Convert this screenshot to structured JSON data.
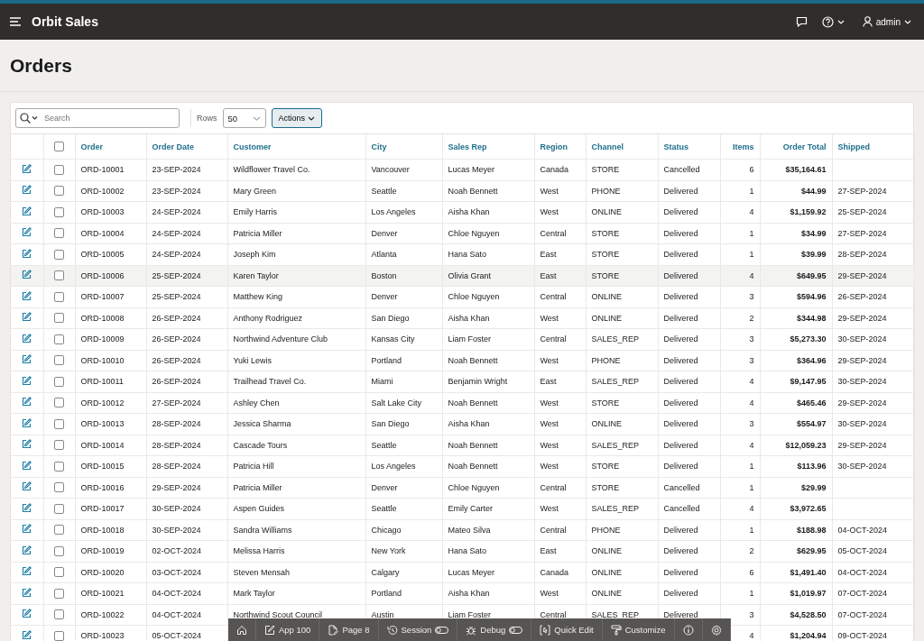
{
  "header": {
    "app_name": "Orbit Sales",
    "user": "admin"
  },
  "page_title": "Orders",
  "toolbar": {
    "search_placeholder": "Search",
    "rows_label": "Rows",
    "rows_value": "50",
    "actions_label": "Actions"
  },
  "select_all_checked": false,
  "columns": [
    "Order",
    "Order Date",
    "Customer",
    "City",
    "Sales Rep",
    "Region",
    "Channel",
    "Status",
    "Items",
    "Order Total",
    "Shipped"
  ],
  "rows": [
    {
      "order": "ORD-10001",
      "date": "23-SEP-2024",
      "customer": "Wildflower Travel Co.",
      "city": "Vancouver",
      "rep": "Lucas Meyer",
      "region": "Canada",
      "channel": "STORE",
      "status": "Cancelled",
      "items": "6",
      "total": "$35,164.61",
      "highlighted": false
    },
    {
      "order": "ORD-10002",
      "date": "23-SEP-2024",
      "customer": "Mary Green",
      "city": "Seattle",
      "rep": "Noah Bennett",
      "region": "West",
      "channel": "PHONE",
      "status": "Delivered",
      "items": "1",
      "total": "$44.99",
      "shipped": "27-SEP-2024",
      "highlighted": false
    },
    {
      "order": "ORD-10003",
      "date": "24-SEP-2024",
      "customer": "Emily Harris",
      "city": "Los Angeles",
      "rep": "Aisha Khan",
      "region": "West",
      "channel": "ONLINE",
      "status": "Delivered",
      "items": "4",
      "total": "$1,159.92",
      "shipped": "25-SEP-2024",
      "highlighted": false
    },
    {
      "order": "ORD-10004",
      "date": "24-SEP-2024",
      "customer": "Patricia Miller",
      "city": "Denver",
      "rep": "Chloe Nguyen",
      "region": "Central",
      "channel": "STORE",
      "status": "Delivered",
      "items": "1",
      "total": "$34.99",
      "shipped": "27-SEP-2024",
      "highlighted": false
    },
    {
      "order": "ORD-10005",
      "date": "24-SEP-2024",
      "customer": "Joseph Kim",
      "city": "Atlanta",
      "rep": "Hana Sato",
      "region": "East",
      "channel": "STORE",
      "status": "Delivered",
      "items": "1",
      "total": "$39.99",
      "shipped": "28-SEP-2024",
      "highlighted": false
    },
    {
      "order": "ORD-10006",
      "date": "25-SEP-2024",
      "customer": "Karen Taylor",
      "city": "Boston",
      "rep": "Olivia Grant",
      "region": "East",
      "channel": "STORE",
      "status": "Delivered",
      "items": "4",
      "total": "$649.95",
      "shipped": "29-SEP-2024",
      "highlighted": true
    },
    {
      "order": "ORD-10007",
      "date": "25-SEP-2024",
      "customer": "Matthew King",
      "city": "Denver",
      "rep": "Chloe Nguyen",
      "region": "Central",
      "channel": "ONLINE",
      "status": "Delivered",
      "items": "3",
      "total": "$594.96",
      "shipped": "26-SEP-2024",
      "highlighted": false
    },
    {
      "order": "ORD-10008",
      "date": "26-SEP-2024",
      "customer": "Anthony Rodriguez",
      "city": "San Diego",
      "rep": "Aisha Khan",
      "region": "West",
      "channel": "ONLINE",
      "status": "Delivered",
      "items": "2",
      "total": "$344.98",
      "shipped": "29-SEP-2024",
      "highlighted": false
    },
    {
      "order": "ORD-10009",
      "date": "26-SEP-2024",
      "customer": "Northwind Adventure Club",
      "city": "Kansas City",
      "rep": "Liam Foster",
      "region": "Central",
      "channel": "SALES_REP",
      "status": "Delivered",
      "items": "3",
      "total": "$5,273.30",
      "shipped": "30-SEP-2024",
      "highlighted": false
    },
    {
      "order": "ORD-10010",
      "date": "26-SEP-2024",
      "customer": "Yuki Lewis",
      "city": "Portland",
      "rep": "Noah Bennett",
      "region": "West",
      "channel": "PHONE",
      "status": "Delivered",
      "items": "3",
      "total": "$364.96",
      "shipped": "29-SEP-2024",
      "highlighted": false
    },
    {
      "order": "ORD-10011",
      "date": "26-SEP-2024",
      "customer": "Trailhead Travel Co.",
      "city": "Miami",
      "rep": "Benjamin Wright",
      "region": "East",
      "channel": "SALES_REP",
      "status": "Delivered",
      "items": "4",
      "total": "$9,147.95",
      "shipped": "30-SEP-2024",
      "highlighted": false
    },
    {
      "order": "ORD-10012",
      "date": "27-SEP-2024",
      "customer": "Ashley Chen",
      "city": "Salt Lake City",
      "rep": "Noah Bennett",
      "region": "West",
      "channel": "STORE",
      "status": "Delivered",
      "items": "4",
      "total": "$465.46",
      "shipped": "29-SEP-2024",
      "highlighted": false
    },
    {
      "order": "ORD-10013",
      "date": "28-SEP-2024",
      "customer": "Jessica Sharma",
      "city": "San Diego",
      "rep": "Aisha Khan",
      "region": "West",
      "channel": "ONLINE",
      "status": "Delivered",
      "items": "3",
      "total": "$554.97",
      "shipped": "30-SEP-2024",
      "highlighted": false
    },
    {
      "order": "ORD-10014",
      "date": "28-SEP-2024",
      "customer": "Cascade Tours",
      "city": "Seattle",
      "rep": "Noah Bennett",
      "region": "West",
      "channel": "SALES_REP",
      "status": "Delivered",
      "items": "4",
      "total": "$12,059.23",
      "shipped": "29-SEP-2024",
      "highlighted": false
    },
    {
      "order": "ORD-10015",
      "date": "28-SEP-2024",
      "customer": "Patricia Hill",
      "city": "Los Angeles",
      "rep": "Noah Bennett",
      "region": "West",
      "channel": "STORE",
      "status": "Delivered",
      "items": "1",
      "total": "$113.96",
      "shipped": "30-SEP-2024",
      "highlighted": false
    },
    {
      "order": "ORD-10016",
      "date": "29-SEP-2024",
      "customer": "Patricia Miller",
      "city": "Denver",
      "rep": "Chloe Nguyen",
      "region": "Central",
      "channel": "STORE",
      "status": "Cancelled",
      "items": "1",
      "total": "$29.99",
      "highlighted": false
    },
    {
      "order": "ORD-10017",
      "date": "30-SEP-2024",
      "customer": "Aspen Guides",
      "city": "Seattle",
      "rep": "Emily Carter",
      "region": "West",
      "channel": "SALES_REP",
      "status": "Cancelled",
      "items": "4",
      "total": "$3,972.65",
      "highlighted": false
    },
    {
      "order": "ORD-10018",
      "date": "30-SEP-2024",
      "customer": "Sandra Williams",
      "city": "Chicago",
      "rep": "Mateo Silva",
      "region": "Central",
      "channel": "PHONE",
      "status": "Delivered",
      "items": "1",
      "total": "$188.98",
      "shipped": "04-OCT-2024",
      "highlighted": false
    },
    {
      "order": "ORD-10019",
      "date": "02-OCT-2024",
      "customer": "Melissa Harris",
      "city": "New York",
      "rep": "Hana Sato",
      "region": "East",
      "channel": "ONLINE",
      "status": "Delivered",
      "items": "2",
      "total": "$629.95",
      "shipped": "05-OCT-2024",
      "highlighted": false
    },
    {
      "order": "ORD-10020",
      "date": "03-OCT-2024",
      "customer": "Steven Mensah",
      "city": "Calgary",
      "rep": "Lucas Meyer",
      "region": "Canada",
      "channel": "ONLINE",
      "status": "Delivered",
      "items": "6",
      "total": "$1,491.40",
      "shipped": "04-OCT-2024",
      "highlighted": false
    },
    {
      "order": "ORD-10021",
      "date": "04-OCT-2024",
      "customer": "Mark Taylor",
      "city": "Portland",
      "rep": "Aisha Khan",
      "region": "West",
      "channel": "ONLINE",
      "status": "Delivered",
      "items": "1",
      "total": "$1,019.97",
      "shipped": "07-OCT-2024",
      "highlighted": false
    },
    {
      "order": "ORD-10022",
      "date": "04-OCT-2024",
      "customer": "Northwind Scout Council",
      "city": "Austin",
      "rep": "Liam Foster",
      "region": "Central",
      "channel": "SALES_REP",
      "status": "Delivered",
      "items": "3",
      "total": "$4,528.50",
      "shipped": "07-OCT-2024",
      "highlighted": false
    },
    {
      "order": "ORD-10023",
      "date": "05-OCT-2024",
      "items": "4",
      "total": "$1,204.94",
      "shipped": "09-OCT-2024",
      "highlighted": false
    }
  ],
  "dev_toolbar": [
    {
      "kind": "home"
    },
    {
      "kind": "app",
      "label": "App 100"
    },
    {
      "kind": "page",
      "label": "Page 8"
    },
    {
      "kind": "session",
      "label": "Session",
      "on": false
    },
    {
      "kind": "debug",
      "label": "Debug",
      "on": false
    },
    {
      "kind": "quick_edit",
      "label": "Quick Edit"
    },
    {
      "kind": "customize",
      "label": "Customize"
    },
    {
      "kind": "info"
    },
    {
      "kind": "settings"
    }
  ]
}
